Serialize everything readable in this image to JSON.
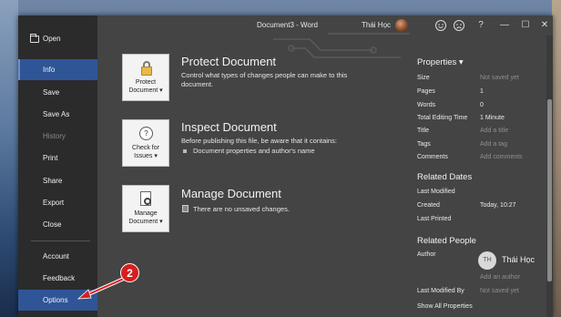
{
  "window": {
    "title": "Document3  -  Word",
    "user_name": "Thái Học"
  },
  "nav": {
    "items": [
      {
        "label": "Open"
      },
      {
        "label": "Info"
      },
      {
        "label": "Save"
      },
      {
        "label": "Save As"
      },
      {
        "label": "History"
      },
      {
        "label": "Print"
      },
      {
        "label": "Share"
      },
      {
        "label": "Export"
      },
      {
        "label": "Close"
      },
      {
        "label": "Account"
      },
      {
        "label": "Feedback"
      },
      {
        "label": "Options"
      }
    ]
  },
  "titlebar": {
    "icons": [
      "smiley-icon",
      "frown-icon",
      "help-icon",
      "minimize-icon",
      "restore-icon",
      "close-icon"
    ],
    "help_glyph": "?",
    "min_glyph": "—",
    "restore_glyph": "☐",
    "close_glyph": "✕"
  },
  "sections": {
    "protect": {
      "tile_line1": "Protect",
      "tile_line2": "Document ▾",
      "title": "Protect Document",
      "desc_line1": "Control what types of changes people can make to this",
      "desc_line2": "document."
    },
    "inspect": {
      "tile_line1": "Check for",
      "tile_line2": "Issues ▾",
      "title": "Inspect Document",
      "desc": "Before publishing this file, be aware that it contains:",
      "bullet": "Document properties and author's name"
    },
    "manage": {
      "tile_line1": "Manage",
      "tile_line2": "Document ▾",
      "title": "Manage Document",
      "desc": "There are no unsaved changes."
    }
  },
  "properties": {
    "title": "Properties ▾",
    "rows": [
      {
        "label": "Size",
        "value": "Not saved yet",
        "dim": true
      },
      {
        "label": "Pages",
        "value": "1",
        "dim": false
      },
      {
        "label": "Words",
        "value": "0",
        "dim": false
      },
      {
        "label": "Total Editing Time",
        "value": "1 Minute",
        "dim": false
      },
      {
        "label": "Title",
        "value": "Add a title",
        "dim": true
      },
      {
        "label": "Tags",
        "value": "Add a tag",
        "dim": true
      },
      {
        "label": "Comments",
        "value": "Add comments",
        "dim": true
      }
    ]
  },
  "related_dates": {
    "title": "Related Dates",
    "rows": [
      {
        "label": "Last Modified",
        "value": ""
      },
      {
        "label": "Created",
        "value": "Today, 10:27"
      },
      {
        "label": "Last Printed",
        "value": ""
      }
    ]
  },
  "related_people": {
    "title": "Related People",
    "author_label": "Author",
    "author_initials": "TH",
    "author_name": "Thái Học",
    "add_author": "Add an author",
    "last_modified_by_label": "Last Modified By",
    "last_modified_by_value": "Not saved yet",
    "show_all": "Show All Properties"
  },
  "annotation": {
    "step": "2",
    "color": "#d61f1f"
  }
}
